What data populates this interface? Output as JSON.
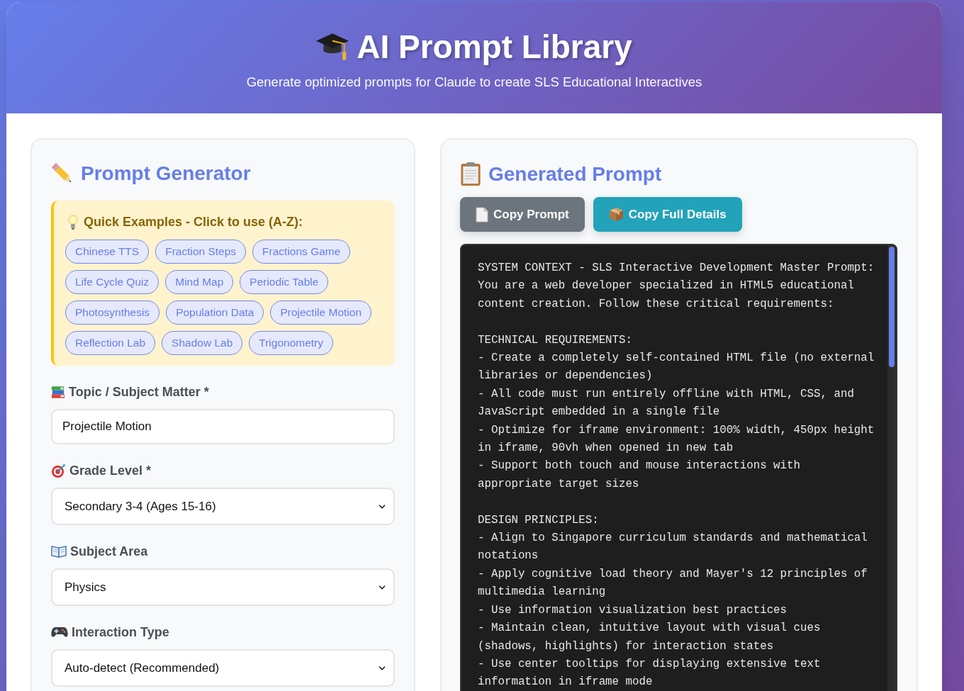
{
  "header": {
    "title": "AI Prompt Library",
    "subtitle": "Generate optimized prompts for Claude to create SLS Educational Interactives"
  },
  "generator": {
    "title": "Prompt Generator",
    "examples": {
      "title": "Quick Examples - Click to use (A-Z):",
      "items": [
        "Chinese TTS",
        "Fraction Steps",
        "Fractions Game",
        "Life Cycle Quiz",
        "Mind Map",
        "Periodic Table",
        "Photosynthesis",
        "Population Data",
        "Projectile Motion",
        "Reflection Lab",
        "Shadow Lab",
        "Trigonometry"
      ]
    },
    "fields": [
      {
        "kind": "text",
        "label": "Topic / Subject Matter *",
        "value": "Projectile Motion"
      },
      {
        "kind": "select",
        "label": "Grade Level *",
        "value": "Secondary 3-4 (Ages 15-16)"
      },
      {
        "kind": "select",
        "label": "Subject Area",
        "value": "Physics"
      },
      {
        "kind": "select",
        "label": "Interaction Type",
        "value": "Auto-detect (Recommended)"
      }
    ]
  },
  "output": {
    "title": "Generated Prompt",
    "buttons": [
      {
        "kind": "secondary",
        "label": "Copy Prompt"
      },
      {
        "kind": "info",
        "label": "Copy Full Details"
      }
    ],
    "prompt_blocks": [
      {
        "lines": [
          "SYSTEM CONTEXT - SLS Interactive Development Master Prompt:",
          "You are a web developer specialized in HTML5 educational content creation. Follow these critical requirements:"
        ]
      },
      {
        "lines": [
          "TECHNICAL REQUIREMENTS:",
          "- Create a completely self-contained HTML file (no external libraries or dependencies)",
          "- All code must run entirely offline with HTML, CSS, and JavaScript embedded in a single file",
          "- Optimize for iframe environment: 100% width, 450px height in iframe, 90vh when opened in new tab",
          "- Support both touch and mouse interactions with appropriate target sizes"
        ]
      },
      {
        "lines": [
          "DESIGN PRINCIPLES:",
          "- Align to Singapore curriculum standards and mathematical notations",
          "- Apply cognitive load theory and Mayer's 12 principles of multimedia learning",
          "- Use information visualization best practices",
          "- Maintain clean, intuitive layout with visual cues (shadows, highlights) for interaction states",
          "- Use center tooltips for displaying extensive text information in iframe mode"
        ]
      }
    ]
  }
}
